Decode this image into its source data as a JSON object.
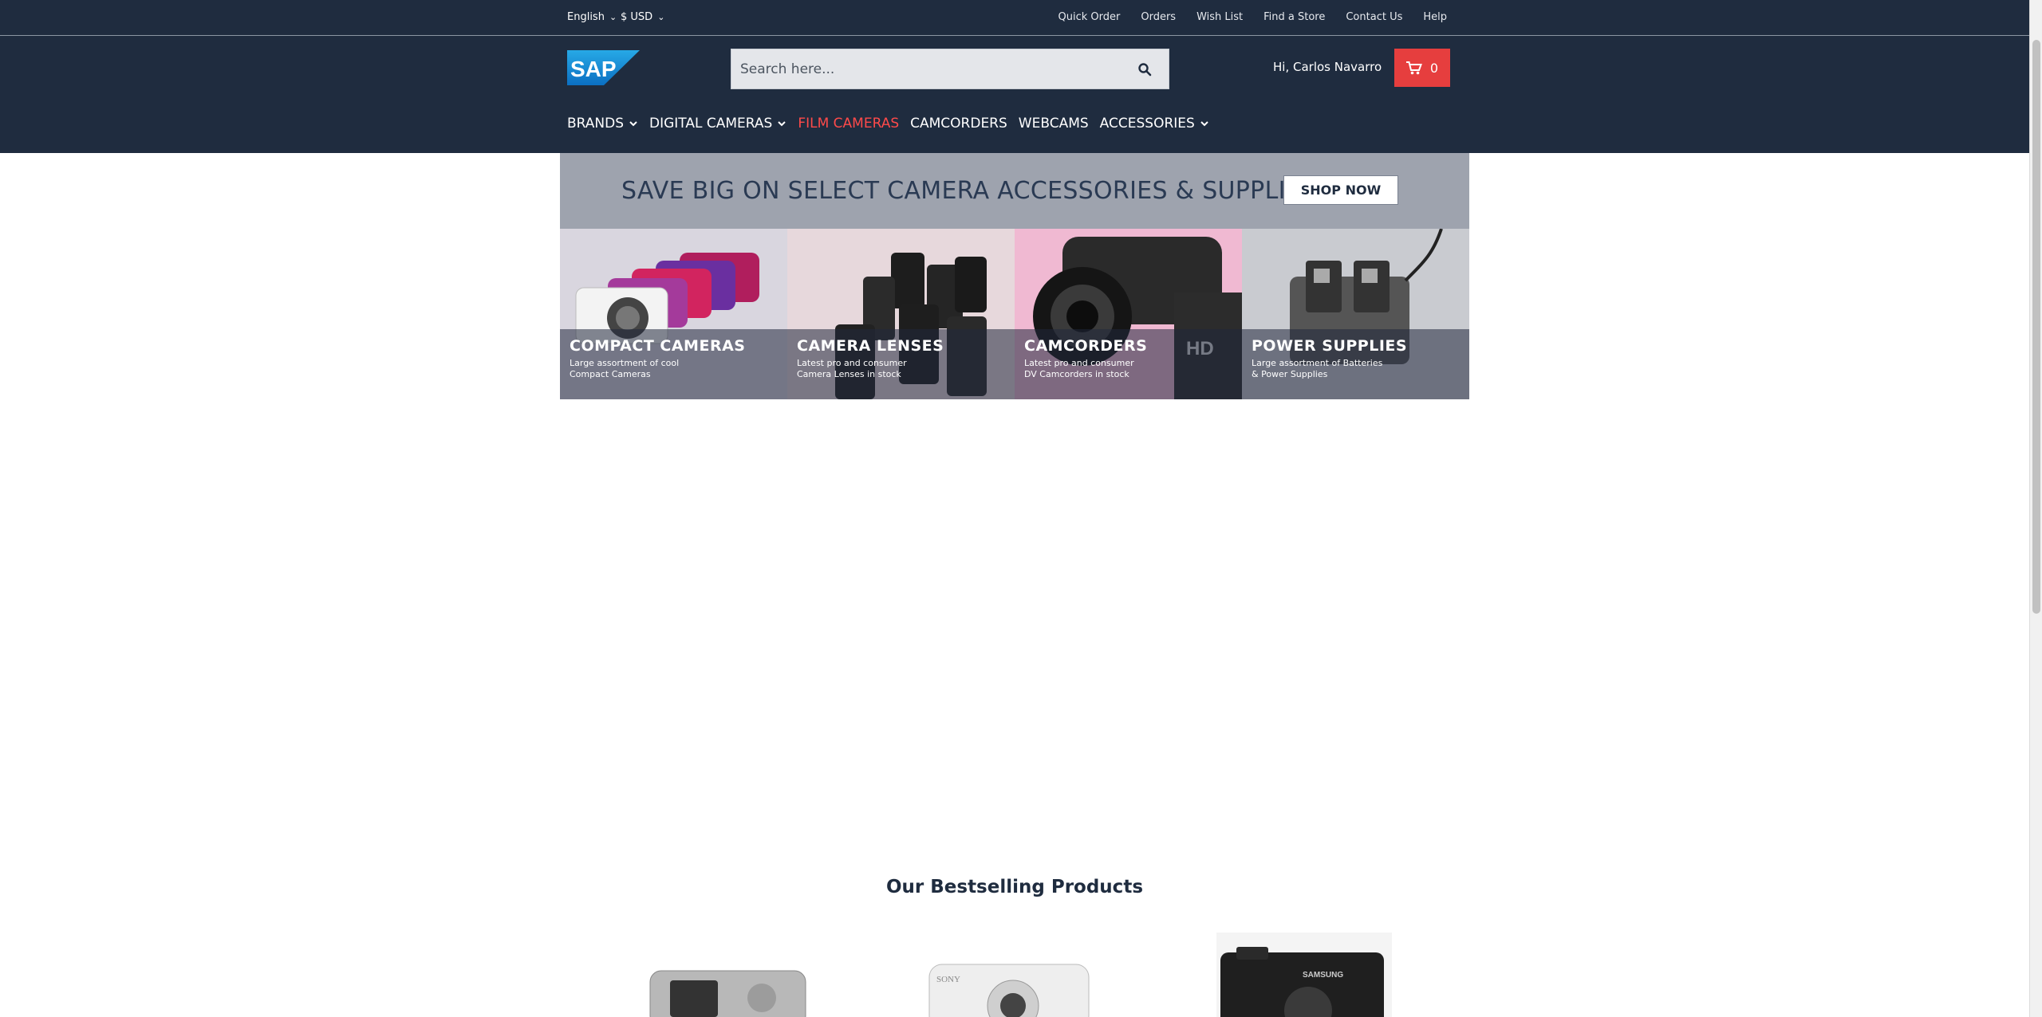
{
  "topbar": {
    "language": "English",
    "currency": "$ USD",
    "links": [
      "Quick Order",
      "Orders",
      "Wish List",
      "Find a Store",
      "Contact Us",
      "Help"
    ]
  },
  "header": {
    "logo_text": "SAP",
    "search_placeholder": "Search here...",
    "greeting": "Hi, Carlos Navarro",
    "cart_count": "0"
  },
  "nav": {
    "items": [
      {
        "label": "BRANDS",
        "dropdown": true,
        "active": false
      },
      {
        "label": "DIGITAL CAMERAS",
        "dropdown": true,
        "active": false
      },
      {
        "label": "FILM CAMERAS",
        "dropdown": false,
        "active": true
      },
      {
        "label": "CAMCORDERS",
        "dropdown": false,
        "active": false
      },
      {
        "label": "WEBCAMS",
        "dropdown": false,
        "active": false
      },
      {
        "label": "ACCESSORIES",
        "dropdown": true,
        "active": false
      }
    ]
  },
  "banner": {
    "text": "SAVE BIG ON SELECT CAMERA ACCESSORIES & SUPPLIES",
    "button": "SHOP NOW"
  },
  "tiles": [
    {
      "title": "COMPACT CAMERAS",
      "subtitle": "Large assortment of cool\nCompact Cameras"
    },
    {
      "title": "CAMERA LENSES",
      "subtitle": "Latest pro and consumer\nCamera Lenses in stock"
    },
    {
      "title": "CAMCORDERS",
      "subtitle": "Latest pro and consumer\nDV Camcorders in stock"
    },
    {
      "title": "POWER SUPPLIES",
      "subtitle": "Large assortment of Batteries\n& Power Supplies"
    }
  ],
  "bestsellers": {
    "title": "Our Bestselling Products",
    "product_brands": [
      "",
      "SONY",
      "SAMSUNG"
    ]
  },
  "colors": {
    "header_bg": "#1f2c3f",
    "accent_red": "#e63e3e",
    "active_nav": "#ff4a4a",
    "banner_bg": "#9ea3ae"
  },
  "icons": [
    "sap-logo",
    "chevron-down-icon",
    "search-icon",
    "cart-icon"
  ]
}
